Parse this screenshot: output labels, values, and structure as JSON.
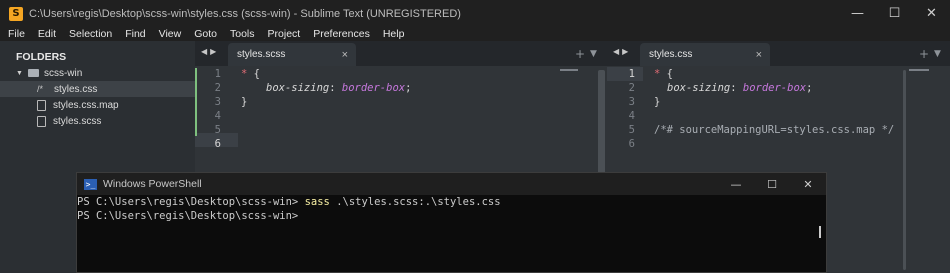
{
  "window": {
    "title": "C:\\Users\\regis\\Desktop\\scss-win\\styles.css (scss-win) - Sublime Text (UNREGISTERED)",
    "app_icon": "sublime-text-icon"
  },
  "menu": [
    "File",
    "Edit",
    "Selection",
    "Find",
    "View",
    "Goto",
    "Tools",
    "Project",
    "Preferences",
    "Help"
  ],
  "sidebar": {
    "header": "FOLDERS",
    "folder": "scss-win",
    "files": [
      {
        "name": "styles.css",
        "icon": "css-file-icon"
      },
      {
        "name": "styles.css.map",
        "icon": "file-icon"
      },
      {
        "name": "styles.scss",
        "icon": "file-icon"
      }
    ]
  },
  "left_pane": {
    "tab": "styles.scss",
    "line_numbers": [
      "1",
      "2",
      "3",
      "4",
      "5",
      "6"
    ],
    "code": {
      "l1_sel": "*",
      "l1_brace": " {",
      "l2_prop": "box-sizing",
      "l2_colon": ": ",
      "l2_val": "border-box",
      "l2_semi": ";",
      "l3": "}"
    }
  },
  "right_pane": {
    "tab": "styles.css",
    "line_numbers": [
      "1",
      "2",
      "3",
      "4",
      "5",
      "6"
    ],
    "code": {
      "l1_sel": "*",
      "l1_brace": " {",
      "l2_prop": "box-sizing",
      "l2_colon": ": ",
      "l2_val": "border-box",
      "l2_semi": ";",
      "l3": "}",
      "l5": "/*# sourceMappingURL=styles.css.map */"
    }
  },
  "powershell": {
    "title": "Windows PowerShell",
    "line1_prompt": "PS C:\\Users\\regis\\Desktop\\scss-win> ",
    "line1_cmd": "sass",
    "line1_args": " .\\styles.scss:.\\styles.css",
    "line2_prompt": "PS C:\\Users\\regis\\Desktop\\scss-win>"
  }
}
